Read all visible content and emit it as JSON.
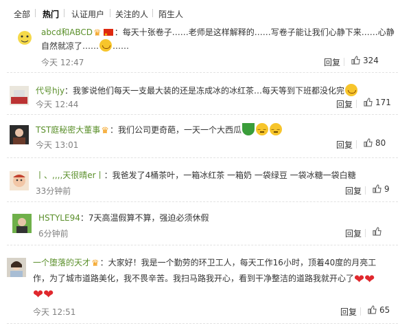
{
  "tabs": {
    "all": "全部",
    "hot": "热门",
    "verified": "认证用户",
    "following": "关注的人",
    "strangers": "陌生人"
  },
  "comments": [
    {
      "user": "abcd和ABCD",
      "text1": "：每天十张卷子……老师是这样解释的……写卷子能让我们心静下来……心静",
      "text2": "自然就凉了……",
      "text2b": "……",
      "time": "今天 12:47",
      "reply": "回复",
      "likes": "324"
    },
    {
      "user": "代号hjy",
      "text1": "：我爹说他们每天一支最大装的还是冻成冰的冰红茶…每天等到下班都没化完",
      "time": "今天 12:44",
      "reply": "回复",
      "likes": "171"
    },
    {
      "user": "TST庭秘密大董事",
      "text1": "：我们公司更奇葩，一天一个大西瓜",
      "time": "今天 13:01",
      "reply": "回复",
      "likes": "80"
    },
    {
      "user": "丨、,,,,天很晴er丨",
      "text1": "：我爸发了4桶茶叶，一箱冰红茶 一箱奶 一袋绿豆 一袋冰糖一袋白糖",
      "time": "33分钟前",
      "reply": "回复",
      "likes": "9"
    },
    {
      "user": "HSTYLE94",
      "text1": "：7天高温假算不算，强迫必须休假",
      "time": "6分钟前",
      "reply": "回复",
      "likes": ""
    },
    {
      "user": "一个堕落的天才",
      "text1": "：大家好！我是一个勤劳的环卫工人，每天工作16小时，顶着40度的月亮工",
      "text2": "作，为了城市道路美化，我不畏辛苦。我扫马路我开心，看到干净整洁的道路我就开心了",
      "time": "今天 12:51",
      "reply": "回复",
      "likes": "65"
    }
  ],
  "colors": {
    "username": "#5a8f2a",
    "timestamp": "#808080",
    "divider": "#e2e2e2"
  },
  "icons": [
    "thumbs-up-icon",
    "heart-emoji",
    "smile-emoji",
    "watermelon-emoji",
    "china-flag-icon",
    "vip-crown-icon"
  ]
}
